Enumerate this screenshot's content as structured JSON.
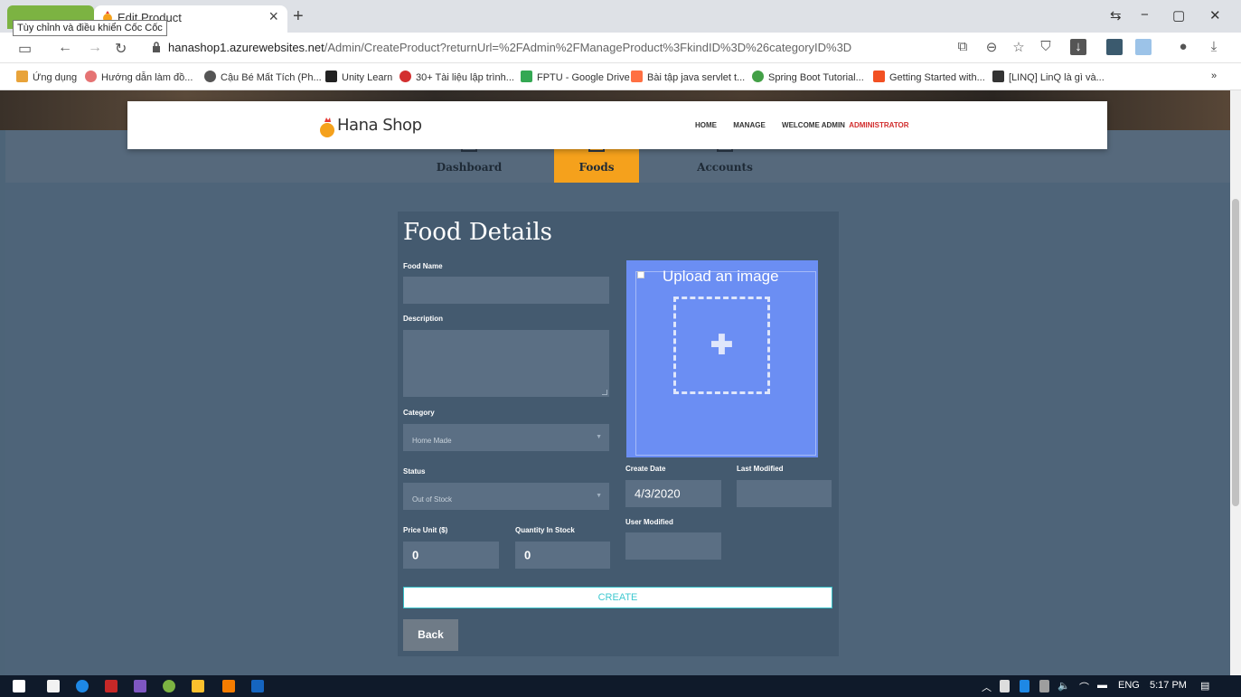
{
  "browser": {
    "tab_title": "Edit Product",
    "tooltip": "Tùy chỉnh và điều khiển Cốc Cốc",
    "url_host": "hanashop1.azurewebsites.net",
    "url_path": "/Admin/CreateProduct?returnUrl=%2FAdmin%2FManageProduct%3FkindID%3D%26categoryID%3D",
    "bookmarks": [
      "Ứng dụng",
      "Hướng dẫn làm đồ...",
      "Cậu Bé Mất Tích (Ph...",
      "Unity Learn",
      "30+ Tài liệu lập trình...",
      "FPTU - Google Drive",
      "Bài tập java servlet t...",
      "Spring Boot Tutorial...",
      "Getting Started with...",
      "[LINQ] LinQ là gì và..."
    ],
    "bookmarks_more": "»"
  },
  "header": {
    "logo_text": "Hana Shop",
    "menu_home": "HOME",
    "menu_manage": "MANAGE",
    "welcome": "WELCOME ADMIN",
    "role": "ADMINISTRATOR"
  },
  "subnav": {
    "dashboard": "Dashboard",
    "foods": "Foods",
    "accounts": "Accounts"
  },
  "form": {
    "title": "Food Details",
    "food_name_label": "Food Name",
    "food_name_value": "",
    "description_label": "Description",
    "description_value": "",
    "category_label": "Category",
    "category_value": "Home Made",
    "status_label": "Status",
    "status_value": "Out of Stock",
    "price_label": "Price Unit ($)",
    "price_value": "0",
    "quantity_label": "Quantity In Stock",
    "quantity_value": "0",
    "upload_title": "Upload an image",
    "create_date_label": "Create Date",
    "create_date_value": "4/3/2020",
    "last_modified_label": "Last Modified",
    "last_modified_value": "",
    "user_modified_label": "User Modified",
    "user_modified_value": "",
    "create_button": "CREATE",
    "back_button": "Back"
  },
  "taskbar": {
    "language": "ENG",
    "time": "5:17 PM"
  }
}
